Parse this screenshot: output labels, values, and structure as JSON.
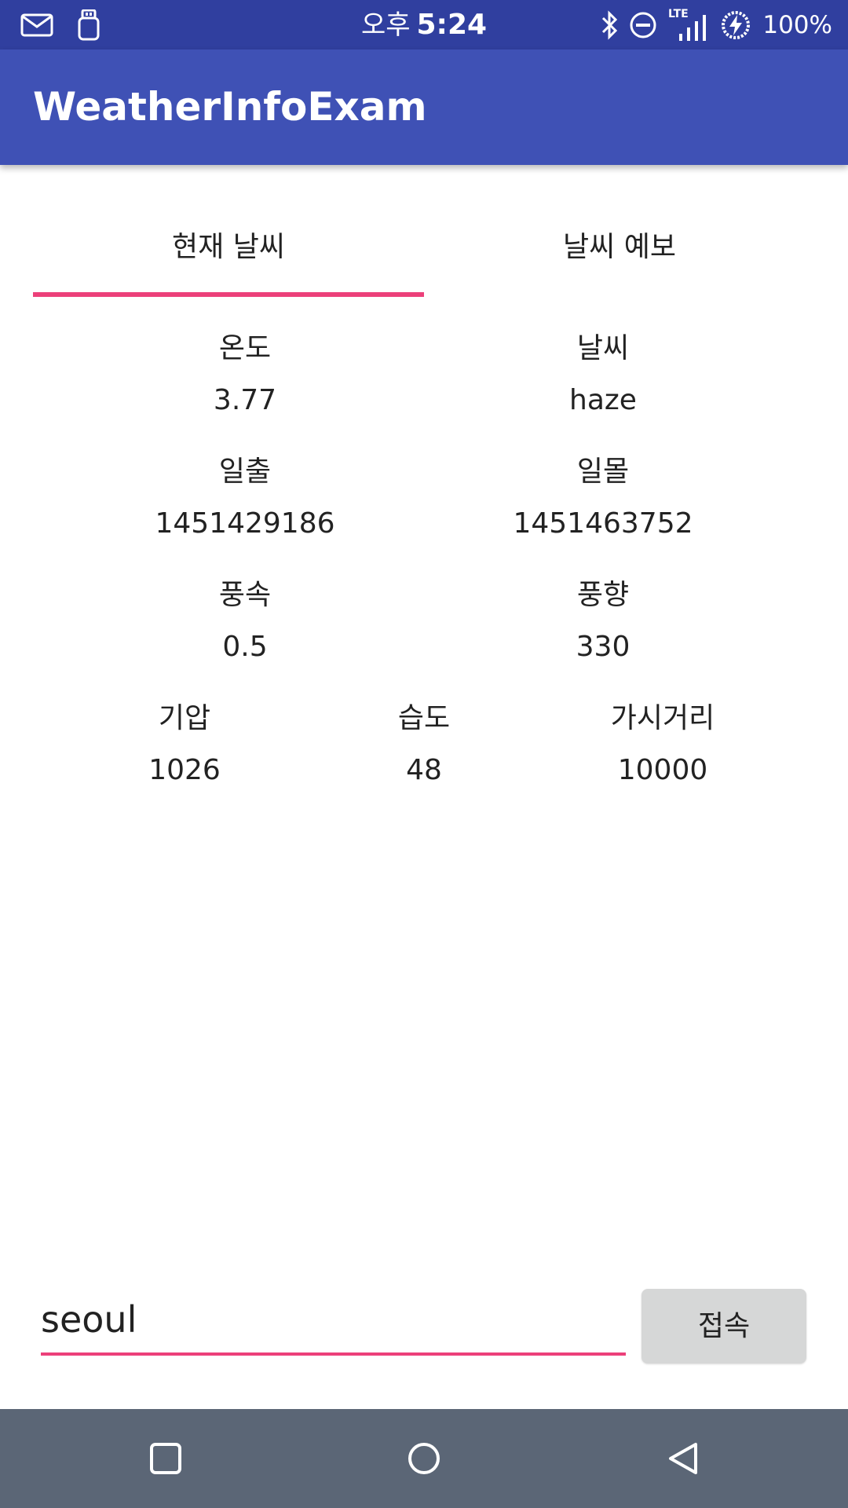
{
  "status_bar": {
    "period": "오후",
    "time": "5:24",
    "network": "LTE",
    "battery": "100%",
    "icons": [
      "mail-icon",
      "usb-icon",
      "bluetooth-icon",
      "do-not-disturb-icon",
      "signal-icon",
      "battery-saver-icon"
    ]
  },
  "app_bar": {
    "title": "WeatherInfoExam"
  },
  "tabs": [
    {
      "label": "현재 날씨",
      "selected": true
    },
    {
      "label": "날씨 예보",
      "selected": false
    }
  ],
  "weather": {
    "temperature": {
      "label": "온도",
      "value": "3.77"
    },
    "condition": {
      "label": "날씨",
      "value": "haze"
    },
    "sunrise": {
      "label": "일출",
      "value": "1451429186"
    },
    "sunset": {
      "label": "일몰",
      "value": "1451463752"
    },
    "wind_speed": {
      "label": "풍속",
      "value": "0.5"
    },
    "wind_direction": {
      "label": "풍향",
      "value": "330"
    },
    "pressure": {
      "label": "기압",
      "value": "1026"
    },
    "humidity": {
      "label": "습도",
      "value": "48"
    },
    "visibility": {
      "label": "가시거리",
      "value": "10000"
    }
  },
  "search": {
    "value": "seoul",
    "button_label": "접속"
  },
  "colors": {
    "status_bar": "#303f9f",
    "app_bar": "#3f51b5",
    "accent": "#ec407a",
    "nav_bar": "#5b6676",
    "button": "#d6d7d7"
  },
  "nav_bar": {
    "buttons": [
      "recents-icon",
      "home-icon",
      "back-icon"
    ]
  }
}
